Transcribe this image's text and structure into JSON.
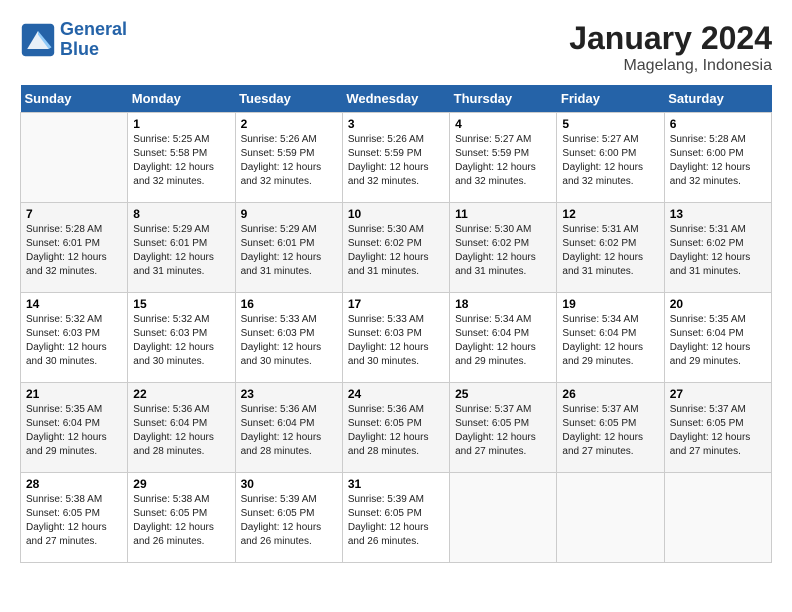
{
  "header": {
    "logo_line1": "General",
    "logo_line2": "Blue",
    "month_year": "January 2024",
    "location": "Magelang, Indonesia"
  },
  "weekdays": [
    "Sunday",
    "Monday",
    "Tuesday",
    "Wednesday",
    "Thursday",
    "Friday",
    "Saturday"
  ],
  "weeks": [
    [
      {
        "day": "",
        "sunrise": "",
        "sunset": "",
        "daylight": ""
      },
      {
        "day": "1",
        "sunrise": "Sunrise: 5:25 AM",
        "sunset": "Sunset: 5:58 PM",
        "daylight": "Daylight: 12 hours and 32 minutes."
      },
      {
        "day": "2",
        "sunrise": "Sunrise: 5:26 AM",
        "sunset": "Sunset: 5:59 PM",
        "daylight": "Daylight: 12 hours and 32 minutes."
      },
      {
        "day": "3",
        "sunrise": "Sunrise: 5:26 AM",
        "sunset": "Sunset: 5:59 PM",
        "daylight": "Daylight: 12 hours and 32 minutes."
      },
      {
        "day": "4",
        "sunrise": "Sunrise: 5:27 AM",
        "sunset": "Sunset: 5:59 PM",
        "daylight": "Daylight: 12 hours and 32 minutes."
      },
      {
        "day": "5",
        "sunrise": "Sunrise: 5:27 AM",
        "sunset": "Sunset: 6:00 PM",
        "daylight": "Daylight: 12 hours and 32 minutes."
      },
      {
        "day": "6",
        "sunrise": "Sunrise: 5:28 AM",
        "sunset": "Sunset: 6:00 PM",
        "daylight": "Daylight: 12 hours and 32 minutes."
      }
    ],
    [
      {
        "day": "7",
        "sunrise": "Sunrise: 5:28 AM",
        "sunset": "Sunset: 6:01 PM",
        "daylight": "Daylight: 12 hours and 32 minutes."
      },
      {
        "day": "8",
        "sunrise": "Sunrise: 5:29 AM",
        "sunset": "Sunset: 6:01 PM",
        "daylight": "Daylight: 12 hours and 31 minutes."
      },
      {
        "day": "9",
        "sunrise": "Sunrise: 5:29 AM",
        "sunset": "Sunset: 6:01 PM",
        "daylight": "Daylight: 12 hours and 31 minutes."
      },
      {
        "day": "10",
        "sunrise": "Sunrise: 5:30 AM",
        "sunset": "Sunset: 6:02 PM",
        "daylight": "Daylight: 12 hours and 31 minutes."
      },
      {
        "day": "11",
        "sunrise": "Sunrise: 5:30 AM",
        "sunset": "Sunset: 6:02 PM",
        "daylight": "Daylight: 12 hours and 31 minutes."
      },
      {
        "day": "12",
        "sunrise": "Sunrise: 5:31 AM",
        "sunset": "Sunset: 6:02 PM",
        "daylight": "Daylight: 12 hours and 31 minutes."
      },
      {
        "day": "13",
        "sunrise": "Sunrise: 5:31 AM",
        "sunset": "Sunset: 6:02 PM",
        "daylight": "Daylight: 12 hours and 31 minutes."
      }
    ],
    [
      {
        "day": "14",
        "sunrise": "Sunrise: 5:32 AM",
        "sunset": "Sunset: 6:03 PM",
        "daylight": "Daylight: 12 hours and 30 minutes."
      },
      {
        "day": "15",
        "sunrise": "Sunrise: 5:32 AM",
        "sunset": "Sunset: 6:03 PM",
        "daylight": "Daylight: 12 hours and 30 minutes."
      },
      {
        "day": "16",
        "sunrise": "Sunrise: 5:33 AM",
        "sunset": "Sunset: 6:03 PM",
        "daylight": "Daylight: 12 hours and 30 minutes."
      },
      {
        "day": "17",
        "sunrise": "Sunrise: 5:33 AM",
        "sunset": "Sunset: 6:03 PM",
        "daylight": "Daylight: 12 hours and 30 minutes."
      },
      {
        "day": "18",
        "sunrise": "Sunrise: 5:34 AM",
        "sunset": "Sunset: 6:04 PM",
        "daylight": "Daylight: 12 hours and 29 minutes."
      },
      {
        "day": "19",
        "sunrise": "Sunrise: 5:34 AM",
        "sunset": "Sunset: 6:04 PM",
        "daylight": "Daylight: 12 hours and 29 minutes."
      },
      {
        "day": "20",
        "sunrise": "Sunrise: 5:35 AM",
        "sunset": "Sunset: 6:04 PM",
        "daylight": "Daylight: 12 hours and 29 minutes."
      }
    ],
    [
      {
        "day": "21",
        "sunrise": "Sunrise: 5:35 AM",
        "sunset": "Sunset: 6:04 PM",
        "daylight": "Daylight: 12 hours and 29 minutes."
      },
      {
        "day": "22",
        "sunrise": "Sunrise: 5:36 AM",
        "sunset": "Sunset: 6:04 PM",
        "daylight": "Daylight: 12 hours and 28 minutes."
      },
      {
        "day": "23",
        "sunrise": "Sunrise: 5:36 AM",
        "sunset": "Sunset: 6:04 PM",
        "daylight": "Daylight: 12 hours and 28 minutes."
      },
      {
        "day": "24",
        "sunrise": "Sunrise: 5:36 AM",
        "sunset": "Sunset: 6:05 PM",
        "daylight": "Daylight: 12 hours and 28 minutes."
      },
      {
        "day": "25",
        "sunrise": "Sunrise: 5:37 AM",
        "sunset": "Sunset: 6:05 PM",
        "daylight": "Daylight: 12 hours and 27 minutes."
      },
      {
        "day": "26",
        "sunrise": "Sunrise: 5:37 AM",
        "sunset": "Sunset: 6:05 PM",
        "daylight": "Daylight: 12 hours and 27 minutes."
      },
      {
        "day": "27",
        "sunrise": "Sunrise: 5:37 AM",
        "sunset": "Sunset: 6:05 PM",
        "daylight": "Daylight: 12 hours and 27 minutes."
      }
    ],
    [
      {
        "day": "28",
        "sunrise": "Sunrise: 5:38 AM",
        "sunset": "Sunset: 6:05 PM",
        "daylight": "Daylight: 12 hours and 27 minutes."
      },
      {
        "day": "29",
        "sunrise": "Sunrise: 5:38 AM",
        "sunset": "Sunset: 6:05 PM",
        "daylight": "Daylight: 12 hours and 26 minutes."
      },
      {
        "day": "30",
        "sunrise": "Sunrise: 5:39 AM",
        "sunset": "Sunset: 6:05 PM",
        "daylight": "Daylight: 12 hours and 26 minutes."
      },
      {
        "day": "31",
        "sunrise": "Sunrise: 5:39 AM",
        "sunset": "Sunset: 6:05 PM",
        "daylight": "Daylight: 12 hours and 26 minutes."
      },
      {
        "day": "",
        "sunrise": "",
        "sunset": "",
        "daylight": ""
      },
      {
        "day": "",
        "sunrise": "",
        "sunset": "",
        "daylight": ""
      },
      {
        "day": "",
        "sunrise": "",
        "sunset": "",
        "daylight": ""
      }
    ]
  ]
}
